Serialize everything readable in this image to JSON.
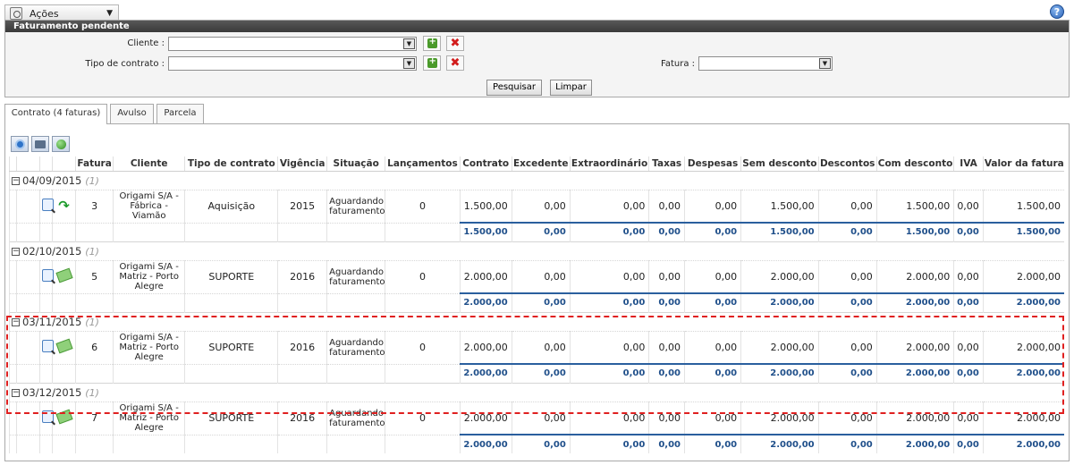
{
  "toolbar": {
    "actions_label": "Ações",
    "help_icon": "help-icon",
    "help_glyph": "?"
  },
  "filter": {
    "title": "Faturamento pendente",
    "cliente_label": "Cliente :",
    "tipo_contrato_label": "Tipo de contrato :",
    "fatura_label": "Fatura :",
    "cliente_value": "",
    "tipo_contrato_value": "",
    "fatura_value": "",
    "search_label": "Pesquisar",
    "clear_label": "Limpar"
  },
  "tabs": [
    {
      "label": "Contrato (4 faturas)",
      "active": true
    },
    {
      "label": "Avulso"
    },
    {
      "label": "Parcela"
    }
  ],
  "grid": {
    "columns": [
      "Fatura",
      "Cliente",
      "Tipo de contrato",
      "Vigência",
      "Situação",
      "Lançamentos",
      "Contrato",
      "Excedente",
      "Extraordinário",
      "Taxas",
      "Despesas",
      "Sem desconto",
      "Descontos",
      "Com desconto",
      "IVA",
      "Valor da fatura"
    ],
    "groups": [
      {
        "date": "04/09/2015",
        "count": "(1)",
        "status_icon": "recurring-arrow-icon",
        "row": {
          "fatura": "3",
          "cliente": "Origami S/A - Fábrica - Viamão",
          "tipo": "Aquisição",
          "vigencia": "2015",
          "situacao": "Aguardando faturamento",
          "lancamentos": "0",
          "contrato": "1.500,00",
          "excedente": "0,00",
          "extraordinario": "0,00",
          "taxas": "0,00",
          "despesas": "0,00",
          "sem_desconto": "1.500,00",
          "descontos": "0,00",
          "com_desconto": "1.500,00",
          "iva": "0,00",
          "valor": "1.500,00"
        },
        "total": {
          "contrato": "1.500,00",
          "excedente": "0,00",
          "extraordinario": "0,00",
          "taxas": "0,00",
          "despesas": "0,00",
          "sem_desconto": "1.500,00",
          "descontos": "0,00",
          "com_desconto": "1.500,00",
          "iva": "0,00",
          "valor": "1.500,00"
        }
      },
      {
        "date": "02/10/2015",
        "count": "(1)",
        "status_icon": "money-icon",
        "row": {
          "fatura": "5",
          "cliente": "Origami S/A - Matriz - Porto Alegre",
          "tipo": "SUPORTE",
          "vigencia": "2016",
          "situacao": "Aguardando faturamento",
          "lancamentos": "0",
          "contrato": "2.000,00",
          "excedente": "0,00",
          "extraordinario": "0,00",
          "taxas": "0,00",
          "despesas": "0,00",
          "sem_desconto": "2.000,00",
          "descontos": "0,00",
          "com_desconto": "2.000,00",
          "iva": "0,00",
          "valor": "2.000,00"
        },
        "total": {
          "contrato": "2.000,00",
          "excedente": "0,00",
          "extraordinario": "0,00",
          "taxas": "0,00",
          "despesas": "0,00",
          "sem_desconto": "2.000,00",
          "descontos": "0,00",
          "com_desconto": "2.000,00",
          "iva": "0,00",
          "valor": "2.000,00"
        }
      },
      {
        "date": "03/11/2015",
        "count": "(1)",
        "status_icon": "money-icon",
        "row": {
          "fatura": "6",
          "cliente": "Origami S/A - Matriz - Porto Alegre",
          "tipo": "SUPORTE",
          "vigencia": "2016",
          "situacao": "Aguardando faturamento",
          "lancamentos": "0",
          "contrato": "2.000,00",
          "excedente": "0,00",
          "extraordinario": "0,00",
          "taxas": "0,00",
          "despesas": "0,00",
          "sem_desconto": "2.000,00",
          "descontos": "0,00",
          "com_desconto": "2.000,00",
          "iva": "0,00",
          "valor": "2.000,00"
        },
        "total": {
          "contrato": "2.000,00",
          "excedente": "0,00",
          "extraordinario": "0,00",
          "taxas": "0,00",
          "despesas": "0,00",
          "sem_desconto": "2.000,00",
          "descontos": "0,00",
          "com_desconto": "2.000,00",
          "iva": "0,00",
          "valor": "2.000,00"
        }
      },
      {
        "date": "03/12/2015",
        "count": "(1)",
        "status_icon": "money-icon",
        "row": {
          "fatura": "7",
          "cliente": "Origami S/A - Matriz - Porto Alegre",
          "tipo": "SUPORTE",
          "vigencia": "2016",
          "situacao": "Aguardando faturamento",
          "lancamentos": "0",
          "contrato": "2.000,00",
          "excedente": "0,00",
          "extraordinario": "0,00",
          "taxas": "0,00",
          "despesas": "0,00",
          "sem_desconto": "2.000,00",
          "descontos": "0,00",
          "com_desconto": "2.000,00",
          "iva": "0,00",
          "valor": "2.000,00"
        },
        "total": {
          "contrato": "2.000,00",
          "excedente": "0,00",
          "extraordinario": "0,00",
          "taxas": "0,00",
          "despesas": "0,00",
          "sem_desconto": "2.000,00",
          "descontos": "0,00",
          "com_desconto": "2.000,00",
          "iva": "0,00",
          "valor": "2.000,00"
        }
      }
    ]
  },
  "colors": {
    "accent": "#1f4f8a",
    "highlight": "#e02020",
    "panel_header": "#3a3a3a"
  }
}
